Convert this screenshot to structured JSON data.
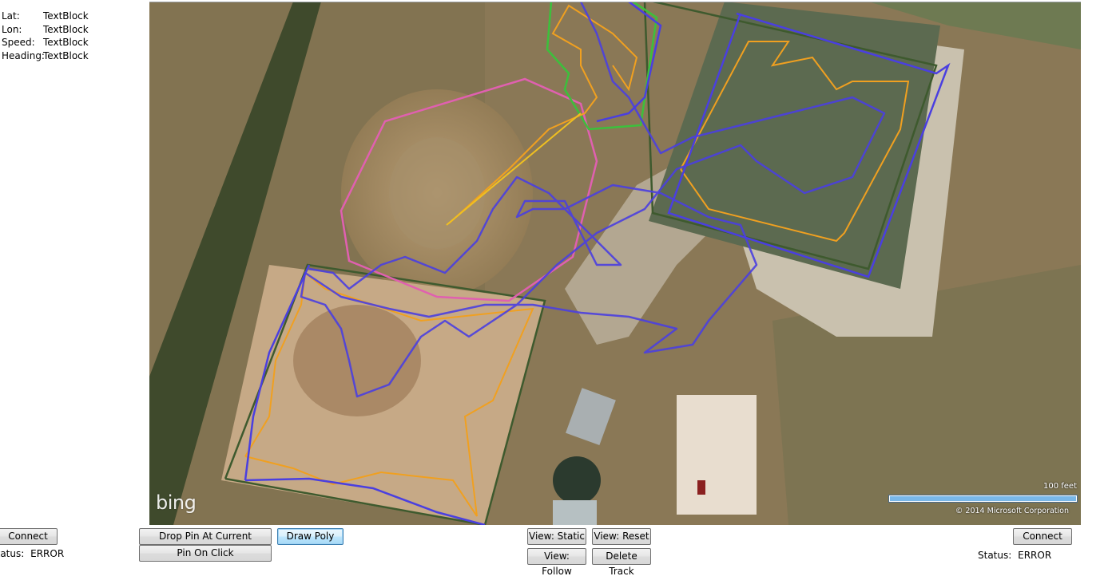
{
  "info_panel": {
    "lat": {
      "label": "Lat:",
      "value": "TextBlock"
    },
    "lon": {
      "label": "Lon:",
      "value": "TextBlock"
    },
    "speed": {
      "label": "Speed:",
      "value": "TextBlock"
    },
    "heading": {
      "label": "Heading:",
      "value": "TextBlock"
    }
  },
  "map": {
    "logo": "bing",
    "scale_label": "100 feet",
    "copyright": "© 2014 Microsoft Corporation",
    "overlay_colors": {
      "track": "#4a3fe0",
      "geofence_pink": "#e060b0",
      "geofence_green": "#3cc03c",
      "route_orange": "#f0a020",
      "boundary_dark": "#3e5a2e"
    }
  },
  "left_panel": {
    "connect_label": "Connect",
    "status_label": "Status:",
    "status_value": "ERROR"
  },
  "right_panel": {
    "connect_label": "Connect",
    "status_label": "Status:",
    "status_value": "ERROR"
  },
  "toolbar": {
    "drop_pin_label": "Drop Pin At Current Location",
    "pin_on_click_label": "Pin On Click",
    "draw_poly_label": "Draw Poly",
    "view_static_label": "View: Static",
    "view_reset_label": "View: Reset",
    "view_follow_label": "View: Follow",
    "delete_track_label": "Delete Track"
  }
}
